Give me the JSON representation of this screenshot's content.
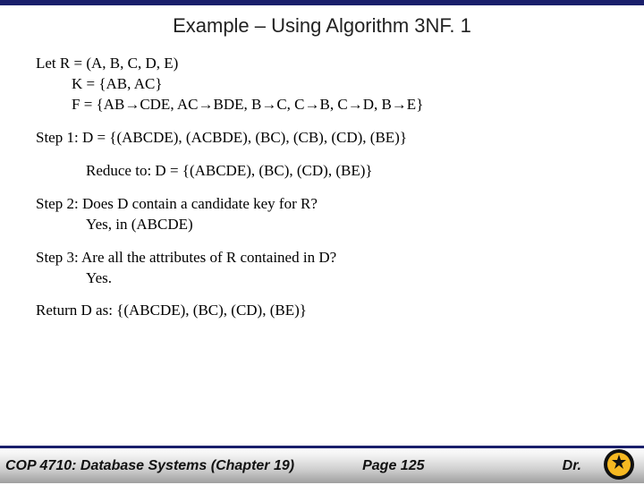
{
  "title": "Example – Using Algorithm 3NF. 1",
  "lines": {
    "letR": "Let R = (A, B, C, D, E)",
    "K": "K = {AB, AC}",
    "F": "F = {AB→CDE, AC→BDE, B→C, C→B, C→D, B→E}",
    "step1": "Step 1: D = {(ABCDE), (ACBDE), (BC), (CB), (CD), (BE)}",
    "reduce": "Reduce to: D = {(ABCDE), (BC), (CD), (BE)}",
    "step2a": "Step 2: Does D contain a candidate key for R?",
    "step2b": "Yes, in (ABCDE)",
    "step3a": "Step 3: Are all the attributes of R contained in D?",
    "step3b": "Yes.",
    "return": "Return D as: {(ABCDE), (BC), (CD), (BE)}"
  },
  "footer": {
    "course": "COP 4710: Database Systems  (Chapter 19)",
    "page": "Page 125",
    "author": "Dr."
  }
}
